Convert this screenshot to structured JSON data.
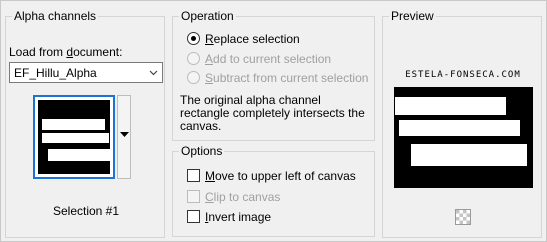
{
  "alpha_channels": {
    "title": "Alpha channels",
    "load_label_prefix": "Load from ",
    "load_label_u": "d",
    "load_label_suffix": "ocument:",
    "document_value": "EF_Hillu_Alpha",
    "selection_caption": "Selection #1"
  },
  "operation": {
    "title": "Operation",
    "options": [
      {
        "u": "R",
        "rest": "eplace selection",
        "selected": true,
        "enabled": true
      },
      {
        "u": "A",
        "rest": "dd to current selection",
        "selected": false,
        "enabled": false
      },
      {
        "u": "S",
        "rest": "ubtract from current selection",
        "selected": false,
        "enabled": false
      }
    ],
    "description_lines": [
      "The original alpha channel",
      "rectangle completely intersects the",
      "canvas."
    ]
  },
  "options": {
    "title": "Options",
    "items": [
      {
        "u": "M",
        "rest": "ove to upper left of canvas",
        "checked": false,
        "enabled": true
      },
      {
        "u": "C",
        "rest": "lip to canvas",
        "checked": false,
        "enabled": false
      },
      {
        "u": "I",
        "rest": "nvert image",
        "checked": false,
        "enabled": true
      }
    ]
  },
  "preview": {
    "title": "Preview",
    "watermark": "ESTELA-FONSECA.COM"
  },
  "colors": {
    "accent": "#1a73d9",
    "background": "#f0f0f0"
  },
  "icons": {
    "combo_arrow": "chevron-down-icon",
    "thumb_dropdown": "caret-down-icon",
    "transparency": "checkerboard-icon"
  }
}
